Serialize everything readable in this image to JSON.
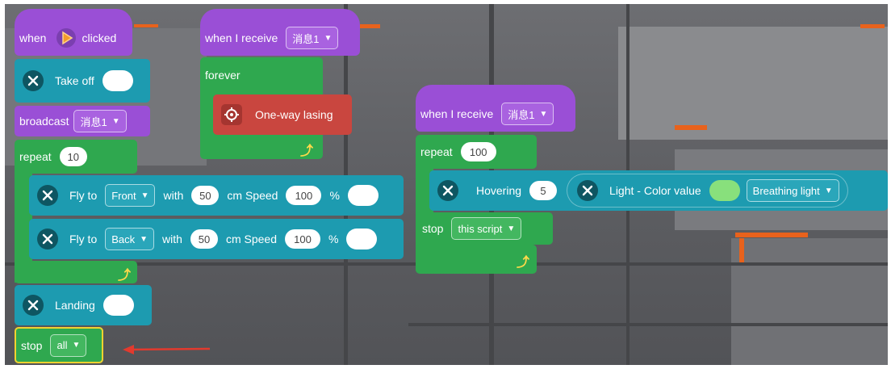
{
  "colors": {
    "event": "#9a4fd6",
    "motion": "#1d9bb0",
    "control": "#2fa84f",
    "action": "#c9463f",
    "highlight": "#f2d230",
    "arrow": "#e23a2e",
    "floor_glow": "#e8621c"
  },
  "icons": {
    "flag": "orange-flag-icon",
    "drone": "drone-icon",
    "laser": "target-icon",
    "loop_arrow": "loop-arrow-icon"
  },
  "script1": {
    "hat": {
      "word_when": "when",
      "word_clicked": "clicked"
    },
    "takeoff": {
      "label": "Take off"
    },
    "broadcast": {
      "label": "broadcast",
      "message": "消息1"
    },
    "repeat": {
      "label": "repeat",
      "count": "10"
    },
    "fly1": {
      "label": "Fly to",
      "direction": "Front",
      "with": "with",
      "distance": "50",
      "unit": "cm Speed",
      "speed": "100",
      "percent": "%"
    },
    "fly2": {
      "label": "Fly to",
      "direction": "Back",
      "with": "with",
      "distance": "50",
      "unit": "cm Speed",
      "speed": "100",
      "percent": "%"
    },
    "landing": {
      "label": "Landing"
    },
    "stop": {
      "label": "stop",
      "option": "all"
    }
  },
  "script2": {
    "hat": {
      "label": "when I receive",
      "message": "消息1"
    },
    "forever": {
      "label": "forever"
    },
    "lasing": {
      "label": "One-way lasing"
    }
  },
  "script3": {
    "hat": {
      "label": "when I receive",
      "message": "消息1"
    },
    "repeat": {
      "label": "repeat",
      "count": "100"
    },
    "hover": {
      "label": "Hovering",
      "value": "5"
    },
    "light": {
      "label": "Light - Color value",
      "mode": "Breathing light",
      "color": "#88e07c"
    },
    "stop": {
      "label": "stop",
      "option": "this script"
    }
  }
}
